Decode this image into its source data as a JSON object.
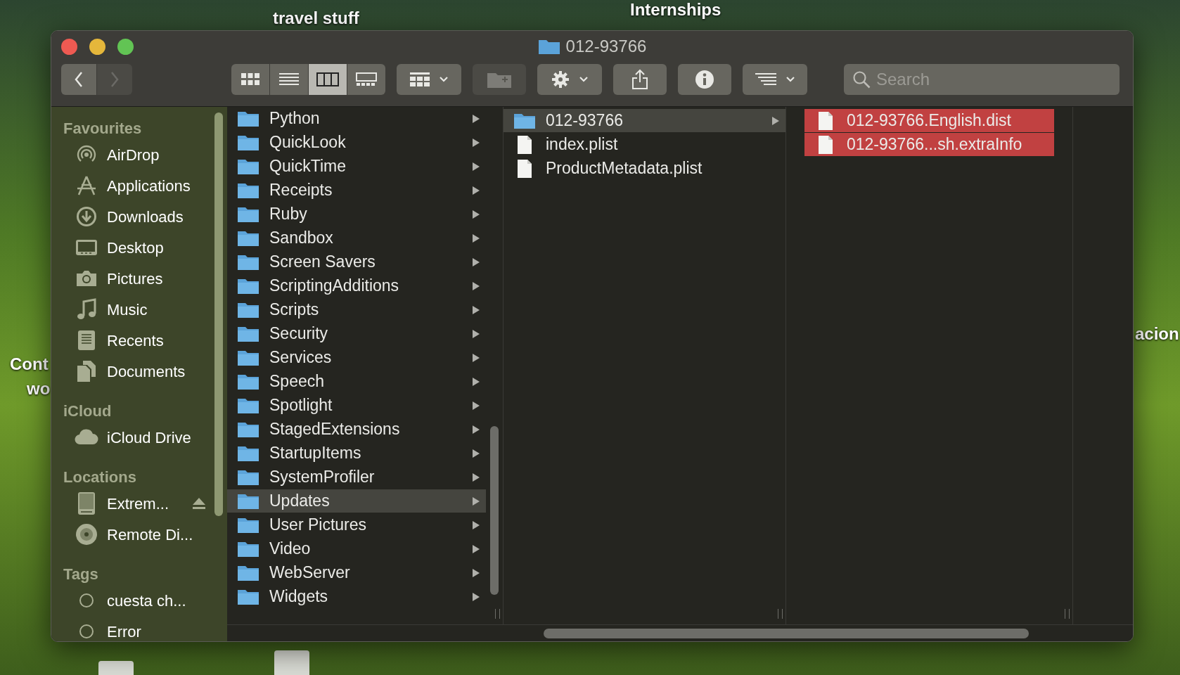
{
  "desktop": {
    "labels": [
      "Internships",
      "travel stuff",
      "Cont",
      "wo",
      "acion"
    ]
  },
  "window": {
    "title": "012-93766"
  },
  "toolbar": {
    "back": {
      "disabled": false
    },
    "forward": {
      "disabled": true
    },
    "view_modes": [
      {
        "selected": false
      },
      {
        "selected": false
      },
      {
        "selected": true
      },
      {
        "selected": false
      }
    ],
    "new_folder": {
      "disabled": true
    },
    "search": {
      "placeholder": "Search"
    }
  },
  "sidebar": [
    {
      "heading": "Favourites",
      "items": [
        {
          "label": "AirDrop"
        },
        {
          "label": "Applications"
        },
        {
          "label": "Downloads"
        },
        {
          "label": "Desktop"
        },
        {
          "label": "Pictures"
        },
        {
          "label": "Music"
        },
        {
          "label": "Recents"
        },
        {
          "label": "Documents"
        }
      ]
    },
    {
      "heading": "iCloud",
      "items": [
        {
          "label": "iCloud Drive"
        }
      ]
    },
    {
      "heading": "Locations",
      "items": [
        {
          "label": "Extrem...",
          "eject": true
        },
        {
          "label": "Remote Di...",
          "eject": false
        }
      ]
    },
    {
      "heading": "Tags",
      "items": [
        {
          "label": "cuesta ch..."
        },
        {
          "label": "Error"
        }
      ]
    }
  ],
  "columns": [
    {
      "active": false,
      "items": [
        {
          "name": "Python",
          "kind": "folder",
          "selected": false
        },
        {
          "name": "QuickLook",
          "kind": "folder",
          "selected": false
        },
        {
          "name": "QuickTime",
          "kind": "folder",
          "selected": false
        },
        {
          "name": "Receipts",
          "kind": "folder",
          "selected": false
        },
        {
          "name": "Ruby",
          "kind": "folder",
          "selected": false
        },
        {
          "name": "Sandbox",
          "kind": "folder",
          "selected": false
        },
        {
          "name": "Screen Savers",
          "kind": "folder",
          "selected": false
        },
        {
          "name": "ScriptingAdditions",
          "kind": "folder",
          "selected": false
        },
        {
          "name": "Scripts",
          "kind": "folder",
          "selected": false
        },
        {
          "name": "Security",
          "kind": "folder",
          "selected": false
        },
        {
          "name": "Services",
          "kind": "folder",
          "selected": false
        },
        {
          "name": "Speech",
          "kind": "folder",
          "selected": false
        },
        {
          "name": "Spotlight",
          "kind": "folder",
          "selected": false
        },
        {
          "name": "StagedExtensions",
          "kind": "folder",
          "selected": false
        },
        {
          "name": "StartupItems",
          "kind": "folder",
          "selected": false
        },
        {
          "name": "SystemProfiler",
          "kind": "folder",
          "selected": false
        },
        {
          "name": "Updates",
          "kind": "folder",
          "selected": true
        },
        {
          "name": "User Pictures",
          "kind": "folder",
          "selected": false
        },
        {
          "name": "Video",
          "kind": "folder",
          "selected": false
        },
        {
          "name": "WebServer",
          "kind": "folder",
          "selected": false
        },
        {
          "name": "Widgets",
          "kind": "folder",
          "selected": false
        }
      ]
    },
    {
      "active": false,
      "items": [
        {
          "name": "012-93766",
          "kind": "folder",
          "selected": true
        },
        {
          "name": "index.plist",
          "kind": "file",
          "selected": false
        },
        {
          "name": "ProductMetadata.plist",
          "kind": "file",
          "selected": false
        }
      ]
    },
    {
      "active": true,
      "items": [
        {
          "name": "012-93766.English.dist",
          "kind": "file",
          "selected": true
        },
        {
          "name": "012-93766...sh.extraInfo",
          "kind": "file",
          "selected": true
        }
      ]
    }
  ]
}
